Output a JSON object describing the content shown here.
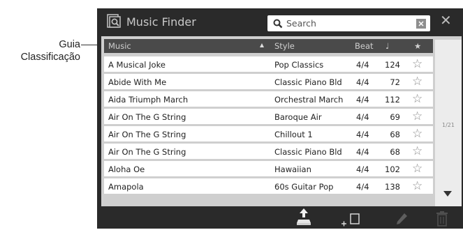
{
  "annotation": {
    "line1": "Guia",
    "line2": "Classificação"
  },
  "window": {
    "title": "Music Finder",
    "search_placeholder": "Search",
    "clear_glyph": "⊠",
    "close_glyph": "✕"
  },
  "table": {
    "headers": {
      "music": "Music",
      "style": "Style",
      "beat": "Beat",
      "tempo": "♩",
      "favorite": "★"
    },
    "rows": [
      {
        "music": "A Musical Joke",
        "style": "Pop Classics",
        "beat": "4/4",
        "tempo": "124",
        "favorite": "☆"
      },
      {
        "music": "Abide With Me",
        "style": "Classic Piano Bld",
        "beat": "4/4",
        "tempo": "72",
        "favorite": "☆"
      },
      {
        "music": "Aida Triumph March",
        "style": "Orchestral March",
        "beat": "4/4",
        "tempo": "112",
        "favorite": "☆"
      },
      {
        "music": "Air On The G String",
        "style": "Baroque Air",
        "beat": "4/4",
        "tempo": "69",
        "favorite": "☆"
      },
      {
        "music": "Air On The G String",
        "style": "Chillout 1",
        "beat": "4/4",
        "tempo": "68",
        "favorite": "☆"
      },
      {
        "music": "Air On The G String",
        "style": "Classic Piano Bld",
        "beat": "4/4",
        "tempo": "68",
        "favorite": "☆"
      },
      {
        "music": "Aloha Oe",
        "style": "Hawaiian",
        "beat": "4/4",
        "tempo": "102",
        "favorite": "☆"
      },
      {
        "music": "Amapola",
        "style": "60s Guitar Pop",
        "beat": "4/4",
        "tempo": "138",
        "favorite": "☆"
      }
    ]
  },
  "pagination": {
    "label": "1/21"
  },
  "icons": {
    "title": "music-finder-icon",
    "search": "search-icon",
    "sort": "sort-ascending-icon",
    "scroll": "scroll-down-icon",
    "export": "export-icon",
    "add": "add-icon",
    "edit": "pencil-icon",
    "delete": "trash-icon"
  },
  "colors": {
    "screen_bg": "#2a2a2a",
    "header_bg": "#4a4a4a",
    "row_bg": "#ffffff",
    "panel_bg": "#cfcfcf"
  }
}
